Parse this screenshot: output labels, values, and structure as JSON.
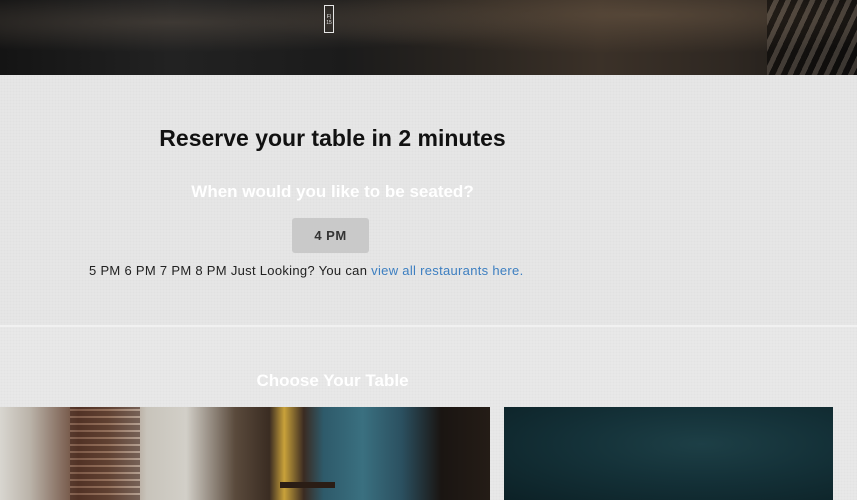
{
  "hero": {
    "logo_text": "F|\n15"
  },
  "reserve": {
    "title": "Reserve your table in 2 minutes",
    "subtitle": "When would you like to be seated?",
    "selected_time": "4 PM",
    "other_times": "5 PM 6 PM 7 PM 8 PM",
    "just_looking": "Just Looking? You can",
    "link_text": "view all restaurants here."
  },
  "choose": {
    "title": "Choose Your Table"
  },
  "colors": {
    "link": "#3d7fc1",
    "button_bg": "#c9c9c9",
    "page_bg": "#e6e6e6"
  }
}
